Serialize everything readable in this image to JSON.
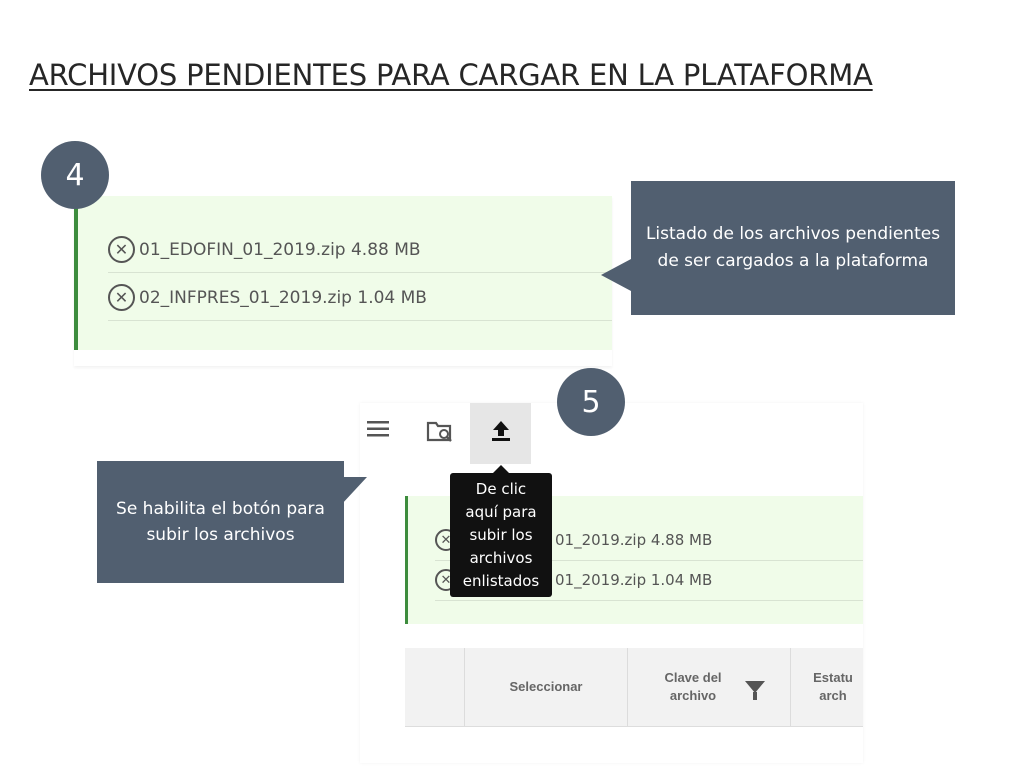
{
  "title": "ARCHIVOS PENDIENTES PARA CARGAR EN LA PLATAFORMA",
  "steps": {
    "four": "4",
    "five": "5"
  },
  "files_top": [
    {
      "name": "01_EDOFIN_01_2019.zip 4.88 MB",
      "icon": "remove-circle-icon"
    },
    {
      "name": "02_INFPRES_01_2019.zip 1.04 MB",
      "icon": "remove-circle-icon"
    }
  ],
  "callout_list": "Listado de los archivos pendientes de ser cargados a la plataforma",
  "callout_button": "Se habilita el botón para subir los archivos",
  "toolbar": {
    "icons": [
      "menu-icon",
      "folder-search-icon",
      "upload-icon"
    ]
  },
  "tooltip": "De clic aquí para subir los archivos enlistados",
  "files_bottom": [
    {
      "name": "01_2019.zip 4.88 MB"
    },
    {
      "name": "01_2019.zip 1.04 MB"
    }
  ],
  "table": {
    "headers": [
      "Seleccionar",
      "Clave del archivo",
      "Estatu arch"
    ]
  },
  "colors": {
    "accent": "#515f70",
    "panel_bg": "#f0fce9",
    "bar": "#3d8c3d"
  }
}
